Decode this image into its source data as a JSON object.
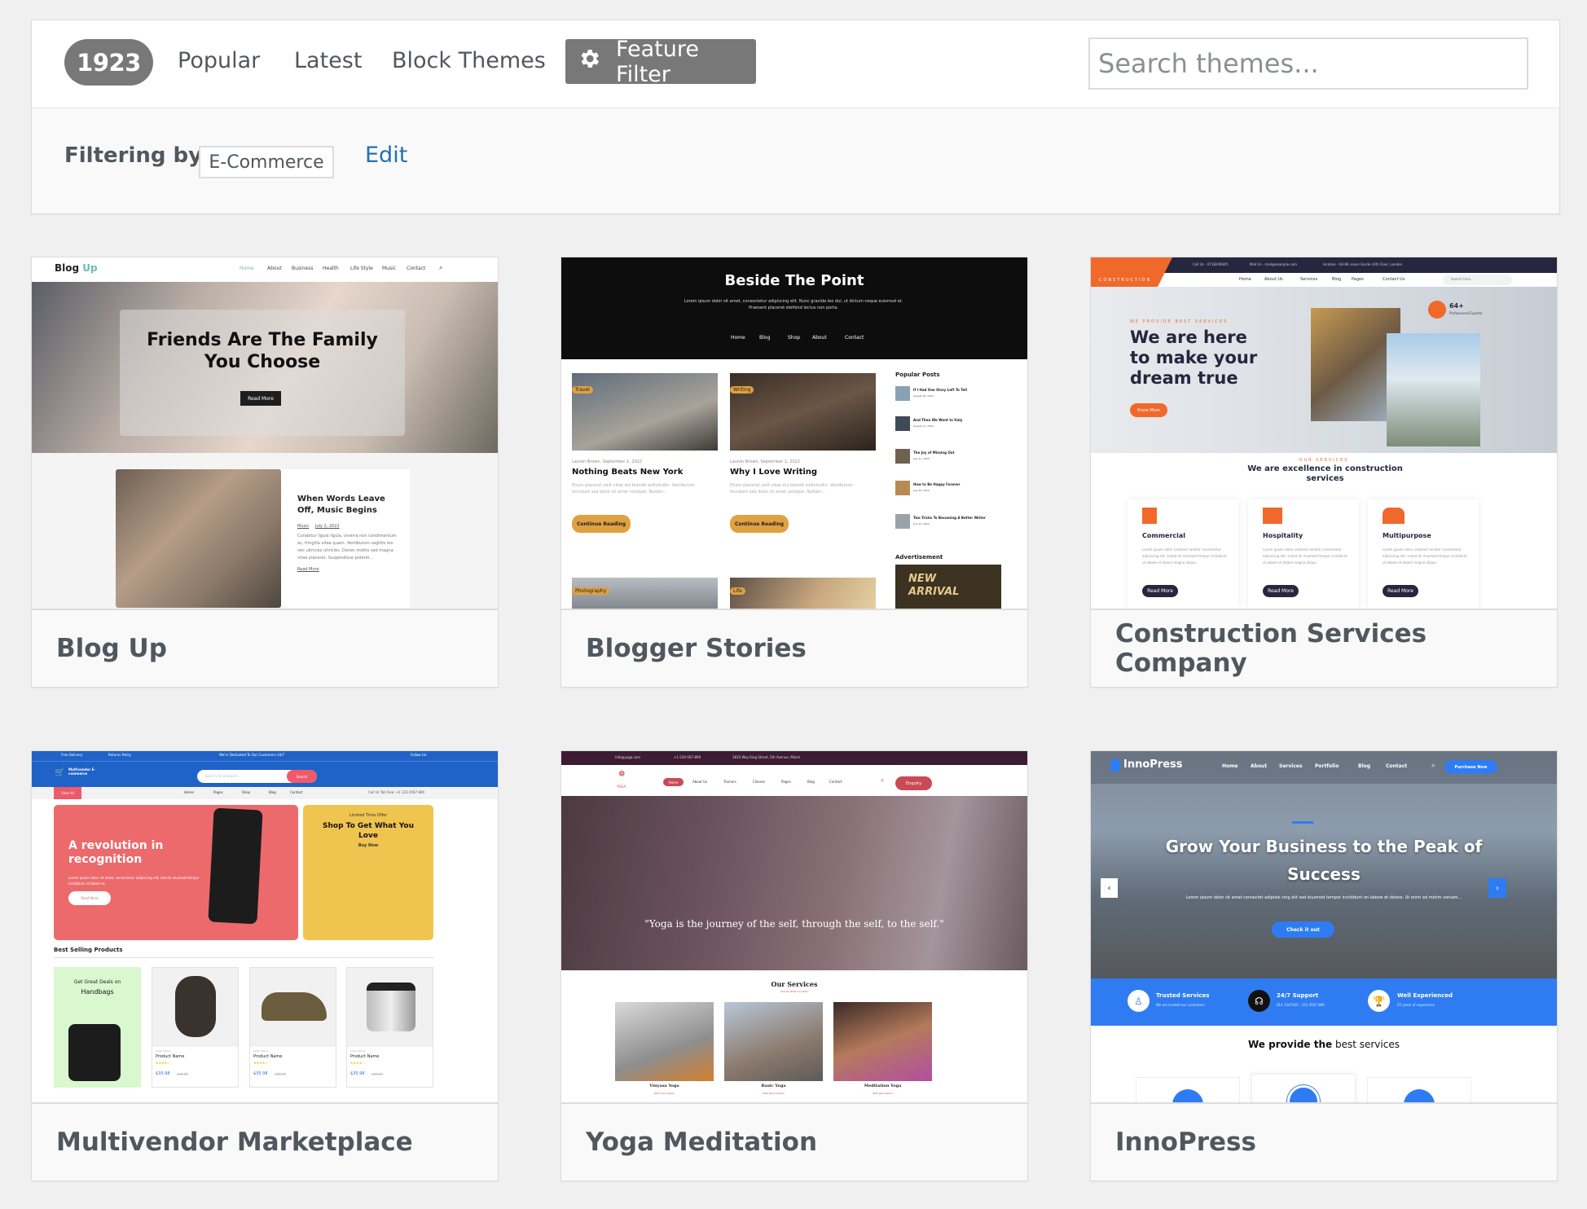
{
  "toolbar": {
    "count": "1923",
    "tabs": [
      "Popular",
      "Latest",
      "Block Themes"
    ],
    "feature_filter_label": "Feature Filter",
    "feature_filter_icon": "gear-icon",
    "search_placeholder": "Search themes...",
    "search_value": ""
  },
  "filter": {
    "label": "Filtering by:",
    "tag": "E-Commerce",
    "edit_label": "Edit"
  },
  "colors": {
    "page_bg": "#f0f0f1",
    "pill_bg": "#787878",
    "link": "#2271b1",
    "text": "#50575e"
  },
  "themes": [
    {
      "name": "Blog Up",
      "preview": {
        "logo_a": "Blog",
        "logo_b": "Up",
        "nav": [
          "Home",
          "About",
          "Business",
          "Health",
          "Life Style",
          "Music",
          "Contact"
        ],
        "hero_title": "Friends Are The Family You Choose",
        "hero_button": "Read More",
        "post_title": "When Words Leave Off, Music Begins",
        "post_cat": "Music",
        "post_date": "July 2, 2022",
        "post_excerpt": "Curabitur ligula ligula, viverra non condimentum ac, fringilla vitae quam. Vestibulum sagittis leo nec ultricies ultricies. Donec mattis sed magna vitae placerat. Suspendisse potenti...",
        "post_link": "Read More"
      }
    },
    {
      "name": "Blogger Stories",
      "preview": {
        "site_title": "Beside The Point",
        "tagline": "Lorem ipsum dolor sit amet, consectetur adipiscing elit. Nunc gravida leo dui, ut dictum neque euismod et. Praesent placerat eleifend lectus non porta.",
        "nav": [
          "Home",
          "Blog",
          "Shop",
          "About",
          "Contact"
        ],
        "posts": [
          {
            "tag": "Travel",
            "meta": "Lauren Brown, September 1, 2022",
            "title": "Nothing Beats New York"
          },
          {
            "tag": "Writing",
            "meta": "Lauren Brown, September 1, 2022",
            "title": "Why I Love Writing"
          }
        ],
        "excerpt": "Etiam placerat velit vitae dui blandit sollicitudin. Vestibulum tincidunt sed dolor sit amet volutpat. Nullam...",
        "continue": "Continue Reading",
        "more_tags": [
          "Photography",
          "Life"
        ],
        "sidebar_title": "Popular Posts",
        "popular": [
          {
            "title": "If I Had One Story Left To Tell",
            "date": "August 18, 2022"
          },
          {
            "title": "And Then We Went to Italy",
            "date": "August 11, 2022"
          },
          {
            "title": "The Joy of Missing Out",
            "date": "July 31, 2022"
          },
          {
            "title": "How to Be Happy Forever",
            "date": "July 30, 2022"
          },
          {
            "title": "Two Tricks To Becoming A Better Writer",
            "date": "July 24, 2022"
          }
        ],
        "ad_title": "Advertisement",
        "ad_text": "NEW ARRIVAL"
      }
    },
    {
      "name": "Construction Services Company",
      "preview": {
        "logo": "CONSTRUCTION",
        "top": [
          "Call Us - 0718249045",
          "Mail Us - mail@example.com",
          "location - 64-66 nason Garde n5th Floor, London"
        ],
        "nav": [
          "Home",
          "About Us",
          "Services",
          "Blog",
          "Pages",
          "Contact Us"
        ],
        "search": "Search here...",
        "kicker": "WE PROVIDE BEST SERVICES",
        "hero_title": "We are here to make your dream true",
        "hero_button": "Know More",
        "experts": "64+",
        "experts_label": "Professional Experts",
        "services_kicker": "OUR SERVICES",
        "services_title": "We are excellence in construction services",
        "services": [
          "Commercial",
          "Hospitality",
          "Multipurpose"
        ],
        "service_text": "Lorem ipsum dolor sisderert ameter consectetur adipiscing elit, seded do eiusmod tempor incididunt ut labore et dolore magna aliqua.",
        "service_button": "Read More"
      }
    },
    {
      "name": "Multivendor Marketplace",
      "preview": {
        "top": [
          "Free Delivery",
          "Returns Policy",
          "We're Dedicated To Our Customers 24/7",
          "Follow Us:"
        ],
        "logo": "Multivendor E-commerce",
        "search_placeholder": "Search for products...",
        "search_button": "Search",
        "view_all": "View All",
        "nav": [
          "Home",
          "Pages",
          "Shop",
          "Blog",
          "Contact"
        ],
        "phone": "Call Us Toll Free: +1 123 4567 890",
        "hero_title": "A revolution in recognition",
        "hero_text": "Lorem ipsum dolor sit amet, consectetur adipiscing elit, sed do eiusmod tempor incididunt ut labore et.",
        "hero_button": "Read More",
        "offer_kicker": "Limited Time Offer",
        "offer_title": "Shop To Get What You Love",
        "offer_button": "Buy Now",
        "section_title": "Best Selling Products",
        "deal_a": "Get Great Deals on",
        "deal_b": "Handbags",
        "product_seller": "Seller Name",
        "product_name": "Product Name",
        "price": "$35.98",
        "old_price": "$48.00"
      }
    },
    {
      "name": "Yoga Meditation",
      "preview": {
        "top": [
          "info@yoga.com",
          "+1-234-567-890",
          "1810 Way King Street, 5th Avenue, Miami"
        ],
        "logo": "YOGA",
        "nav": [
          "Home",
          "About Us",
          "Trainers",
          "Classes",
          "Pages",
          "Blog",
          "Contact"
        ],
        "enquiry": "Enquiry",
        "quote": "\"Yoga is the journey of the self, through the self, to the self.\"",
        "services_title": "Our Services",
        "services_sub": "Choose What You Want",
        "classes": [
          {
            "name": "Vinyasa Yoga",
            "by": "With Anna Alison"
          },
          {
            "name": "Basic Yoga",
            "by": "With Elison Parker"
          },
          {
            "name": "Meditation Yoga",
            "by": "With Jessi Neomi"
          }
        ]
      }
    },
    {
      "name": "InnoPress",
      "preview": {
        "logo": "InnoPress",
        "nav": [
          "Home",
          "About",
          "Services",
          "Portfolio",
          "Blog",
          "Contact"
        ],
        "cta": "Purchase Now",
        "hero_title": "Grow Your Business to the Peak of Success",
        "hero_text": "Lorem ipsum dolor sit amet consectet adipisie cing elit sed eiusmod tempor incididunt on labore et dolore. Ut enim ad minim veniam...",
        "hero_button": "Check it out",
        "features": [
          {
            "title": "Trusted Services",
            "sub": "We are trusted our customers"
          },
          {
            "title": "24/7 Support",
            "sub": "014 1547925 - 123 4567 890"
          },
          {
            "title": "Well Experienced",
            "sub": "25 years of experience"
          }
        ],
        "section_a": "We provide the",
        "section_b": "best services"
      }
    }
  ]
}
